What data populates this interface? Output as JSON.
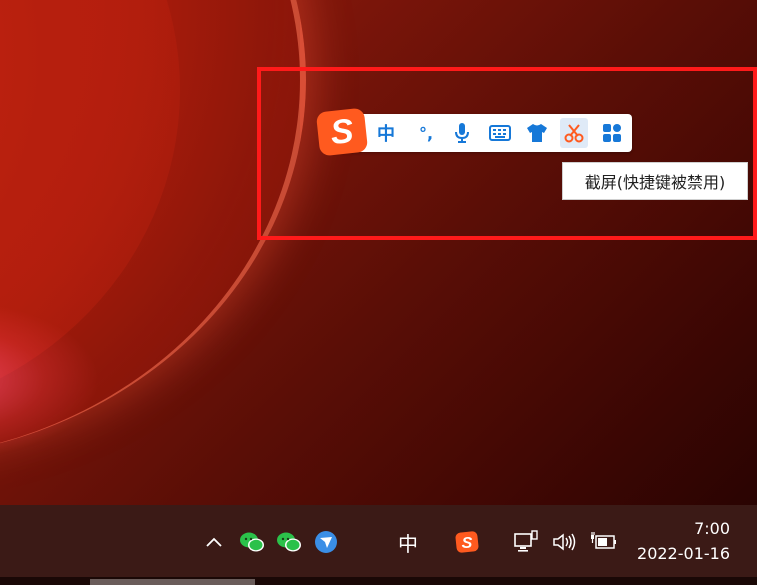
{
  "ime_toolbar": {
    "logo_letter": "S",
    "buttons": [
      {
        "name": "chinese-mode-button",
        "label": "中",
        "icon": "chinese-mode-icon"
      },
      {
        "name": "punctuation-button",
        "label": "°,",
        "icon": "punctuation-icon"
      },
      {
        "name": "voice-input-button",
        "label": "",
        "icon": "microphone-icon"
      },
      {
        "name": "soft-keyboard-button",
        "label": "",
        "icon": "keyboard-icon"
      },
      {
        "name": "skin-button",
        "label": "",
        "icon": "tshirt-icon"
      },
      {
        "name": "screenshot-button",
        "label": "",
        "icon": "scissors-icon"
      },
      {
        "name": "toolbox-button",
        "label": "",
        "icon": "grid-icon"
      }
    ],
    "tooltip": "截屏(快捷键被禁用)"
  },
  "taskbar": {
    "tray_icons": [
      "chevron-up-icon",
      "wechat-icon",
      "wechat-icon",
      "feishu-icon",
      "ime-mode-icon",
      "sogou-icon",
      "network-icon",
      "volume-icon",
      "battery-icon"
    ],
    "ime_mode_label": "中",
    "chevron": "^",
    "time": "7:00",
    "date": "2022-01-16"
  },
  "colors": {
    "accent_blue": "#1678d8",
    "sogou_orange": "#ff5a1f",
    "highlight_red": "#ff1a1a",
    "wechat_green": "#2bc14a"
  }
}
